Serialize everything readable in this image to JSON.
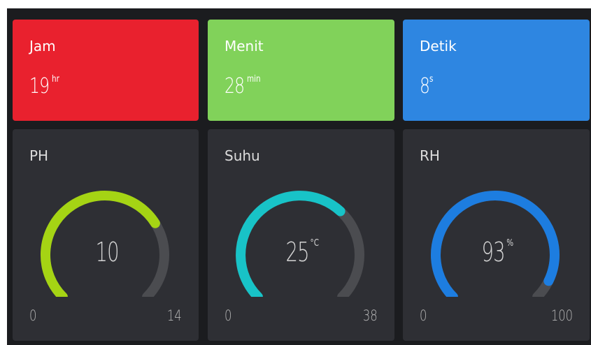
{
  "time_tiles": [
    {
      "label": "Jam",
      "value": "19",
      "unit": "hr",
      "color": "#e9212e"
    },
    {
      "label": "Menit",
      "value": "28",
      "unit": "min",
      "color": "#81d25a"
    },
    {
      "label": "Detik",
      "value": "8",
      "unit": "s",
      "color": "#2e86e1"
    }
  ],
  "gauges": [
    {
      "label": "PH",
      "value": "10",
      "unit": "",
      "min": "0",
      "max": "14",
      "fraction": 0.714,
      "color": "#a5d414"
    },
    {
      "label": "Suhu",
      "value": "25",
      "unit": "°C",
      "min": "0",
      "max": "38",
      "fraction": 0.658,
      "color": "#18c3c7"
    },
    {
      "label": "RH",
      "value": "93",
      "unit": "%",
      "min": "0",
      "max": "100",
      "fraction": 0.93,
      "color": "#1d7de0"
    }
  ],
  "theme": {
    "background": "#1b1c1f",
    "gauge_tile": "#2e2f34",
    "gauge_track": "#4b4c50"
  }
}
